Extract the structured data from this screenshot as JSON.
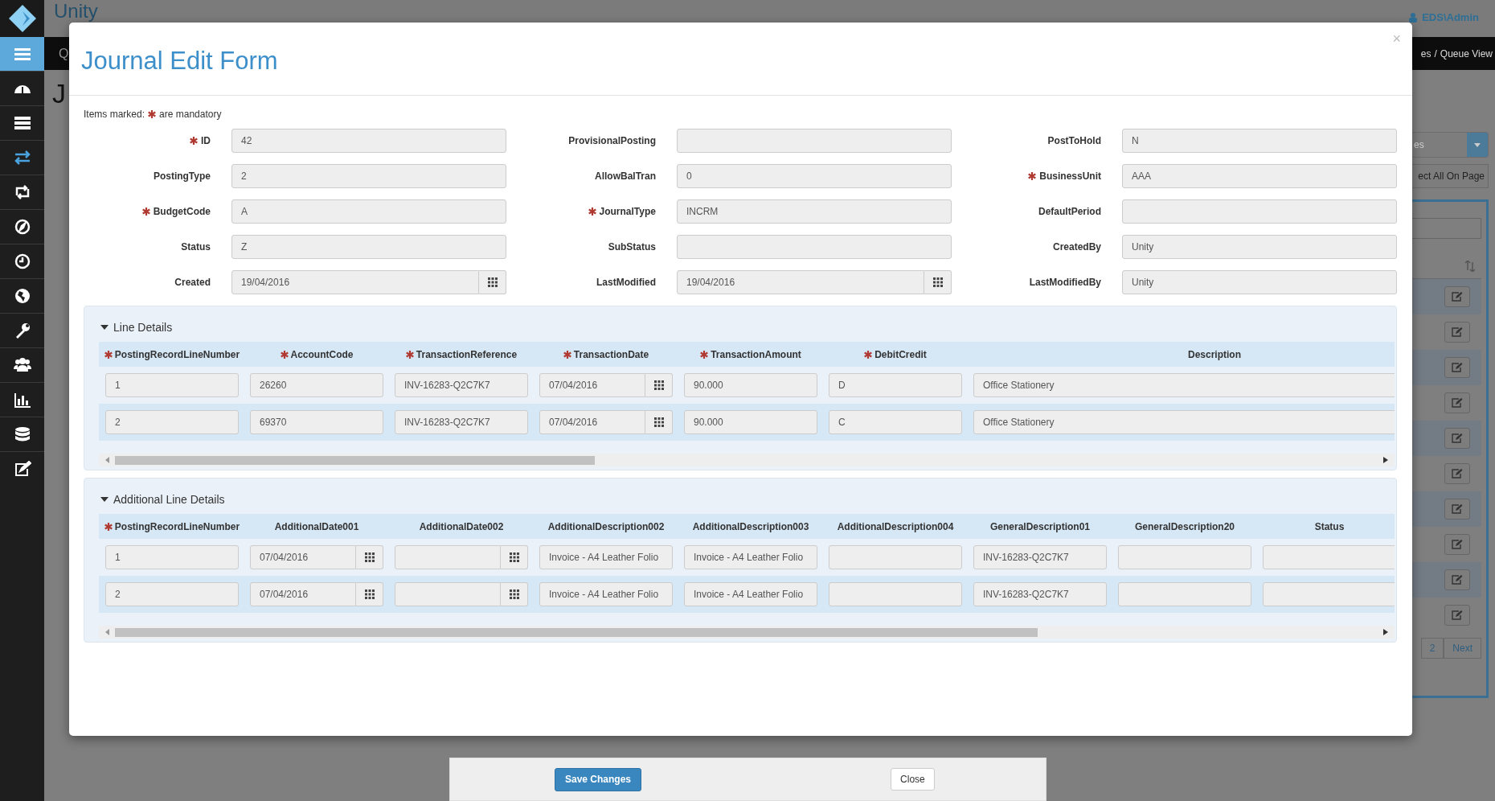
{
  "app": {
    "logo": "Unity",
    "user": "EDS\\Admin"
  },
  "sidebar": {
    "items": [
      {
        "selected": false
      },
      {
        "selected": false
      },
      {
        "selected": true
      },
      {
        "selected": false
      },
      {
        "selected": false
      },
      {
        "selected": false
      },
      {
        "selected": false
      },
      {
        "selected": false
      },
      {
        "selected": false
      },
      {
        "selected": false
      },
      {
        "selected": false
      },
      {
        "selected": false
      }
    ]
  },
  "nav": {
    "left": "Q",
    "breadcrumb": {
      "items": [
        "es",
        "Queue View"
      ],
      "separator": "/"
    }
  },
  "page": {
    "title": "J",
    "dropdown": "es",
    "select_all": "ect All On Page",
    "pagination": [
      "2",
      "Next"
    ]
  },
  "modal": {
    "title": "Journal Edit Form",
    "close": "×",
    "note_before": "Items marked:",
    "note_after": "are mandatory",
    "fields": [
      {
        "label": "ID",
        "value": "42",
        "required": true,
        "kind": "text"
      },
      {
        "label": "ProvisionalPosting",
        "required": false,
        "kind": "text"
      },
      {
        "label": "PostToHold",
        "value": "N",
        "required": false,
        "kind": "text"
      },
      {
        "label": "PostingType",
        "value": "2",
        "required": false,
        "kind": "text"
      },
      {
        "label": "AllowBalTran",
        "value": "0",
        "required": false,
        "kind": "text"
      },
      {
        "label": "BusinessUnit",
        "value": "AAA",
        "required": true,
        "kind": "text"
      },
      {
        "label": "BudgetCode",
        "value": "A",
        "required": true,
        "kind": "text"
      },
      {
        "label": "JournalType",
        "value": "INCRM",
        "required": true,
        "kind": "text"
      },
      {
        "label": "DefaultPeriod",
        "required": false,
        "kind": "text"
      },
      {
        "label": "Status",
        "value": "Z",
        "required": false,
        "kind": "text"
      },
      {
        "label": "SubStatus",
        "required": false,
        "kind": "text"
      },
      {
        "label": "CreatedBy",
        "value": "Unity",
        "required": false,
        "kind": "text"
      },
      {
        "label": "Created",
        "value": "19/04/2016",
        "required": false,
        "kind": "date"
      },
      {
        "label": "LastModified",
        "value": "19/04/2016",
        "required": false,
        "kind": "date"
      },
      {
        "label": "LastModifiedBy",
        "value": "Unity",
        "required": false,
        "kind": "text"
      }
    ],
    "sections": [
      {
        "title": "Line Details",
        "expanded": true,
        "columns": [
          {
            "label": "PostingRecordLineNumber",
            "required": true,
            "kind": "text"
          },
          {
            "label": "AccountCode",
            "required": true,
            "kind": "text"
          },
          {
            "label": "TransactionReference",
            "required": true,
            "kind": "text"
          },
          {
            "label": "TransactionDate",
            "required": true,
            "kind": "date"
          },
          {
            "label": "TransactionAmount",
            "required": true,
            "kind": "text"
          },
          {
            "label": "DebitCredit",
            "required": true,
            "kind": "text"
          },
          {
            "label": "Description",
            "required": false,
            "kind": "wide"
          }
        ],
        "rows": [
          [
            "1",
            "26260",
            "INV-16283-Q2C7K7",
            "07/04/2016",
            "90.000",
            "D",
            "Office Stationery"
          ],
          [
            "2",
            "69370",
            "INV-16283-Q2C7K7",
            "07/04/2016",
            "90.000",
            "C",
            "Office Stationery"
          ]
        ]
      },
      {
        "title": "Additional Line Details",
        "expanded": true,
        "columns": [
          {
            "label": "PostingRecordLineNumber",
            "required": true,
            "kind": "text"
          },
          {
            "label": "AdditionalDate001",
            "required": false,
            "kind": "date"
          },
          {
            "label": "AdditionalDate002",
            "required": false,
            "kind": "date"
          },
          {
            "label": "AdditionalDescription002",
            "required": false,
            "kind": "text"
          },
          {
            "label": "AdditionalDescription003",
            "required": false,
            "kind": "text"
          },
          {
            "label": "AdditionalDescription004",
            "required": false,
            "kind": "text"
          },
          {
            "label": "GeneralDescription01",
            "required": false,
            "kind": "text"
          },
          {
            "label": "GeneralDescription20",
            "required": false,
            "kind": "text"
          },
          {
            "label": "Status",
            "required": false,
            "kind": "text"
          }
        ],
        "rows": [
          [
            "1",
            "07/04/2016",
            null,
            "Invoice - A4 Leather Folio",
            "Invoice - A4 Leather Folio",
            null,
            "INV-16283-Q2C7K7",
            null,
            null
          ],
          [
            "2",
            "07/04/2016",
            null,
            "Invoice - A4 Leather Folio",
            "Invoice - A4 Leather Folio",
            null,
            "INV-16283-Q2C7K7",
            null,
            null
          ]
        ]
      }
    ],
    "footer": {
      "save": "Save Changes",
      "close": "Close"
    }
  }
}
